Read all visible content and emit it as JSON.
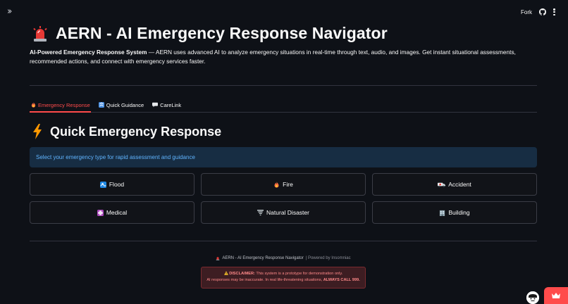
{
  "topbar": {
    "fork_label": "Fork"
  },
  "header": {
    "title": "AERN - AI Emergency Response Navigator",
    "intro_bold": "AI-Powered Emergency Response System",
    "intro_rest": " — AERN uses advanced AI to analyze emergency situations in real-time through text, audio, and images. Get instant situational assessments, recommended actions, and connect with emergency services faster."
  },
  "tabs": [
    {
      "label": "Emergency Response",
      "icon": "fire-icon",
      "active": true
    },
    {
      "label": "Quick Guidance",
      "icon": "guidance-icon",
      "active": false
    },
    {
      "label": "CareLink",
      "icon": "speech-bubble-icon",
      "active": false
    }
  ],
  "section": {
    "title": "Quick Emergency Response",
    "info": "Select your emergency type for rapid assessment and guidance"
  },
  "emergency_buttons": [
    {
      "label": "Flood",
      "icon": "wave-icon"
    },
    {
      "label": "Fire",
      "icon": "fire-icon"
    },
    {
      "label": "Accident",
      "icon": "ambulance-icon"
    },
    {
      "label": "Medical",
      "icon": "medical-icon"
    },
    {
      "label": "Natural Disaster",
      "icon": "tornado-icon"
    },
    {
      "label": "Building",
      "icon": "building-icon"
    }
  ],
  "footer": {
    "app_name": "AERN - AI Emergency Response Navigator",
    "powered_by": " | Powered by Insomniac"
  },
  "disclaimer": {
    "label": "DISCLAIMER:",
    "line1_rest": " This system is a prototype for demonstration only.",
    "line2": "AI responses may be inaccurate. In real life-threatening situations, ",
    "call_text": "ALWAYS CALL 999."
  },
  "colors": {
    "background": "#0e1117",
    "accent": "#ff4b4b",
    "info_bg": "#172d43",
    "info_text": "#60b4ff",
    "disclaimer_bg": "#3d1d22",
    "disclaimer_text": "#ff8a8a"
  }
}
